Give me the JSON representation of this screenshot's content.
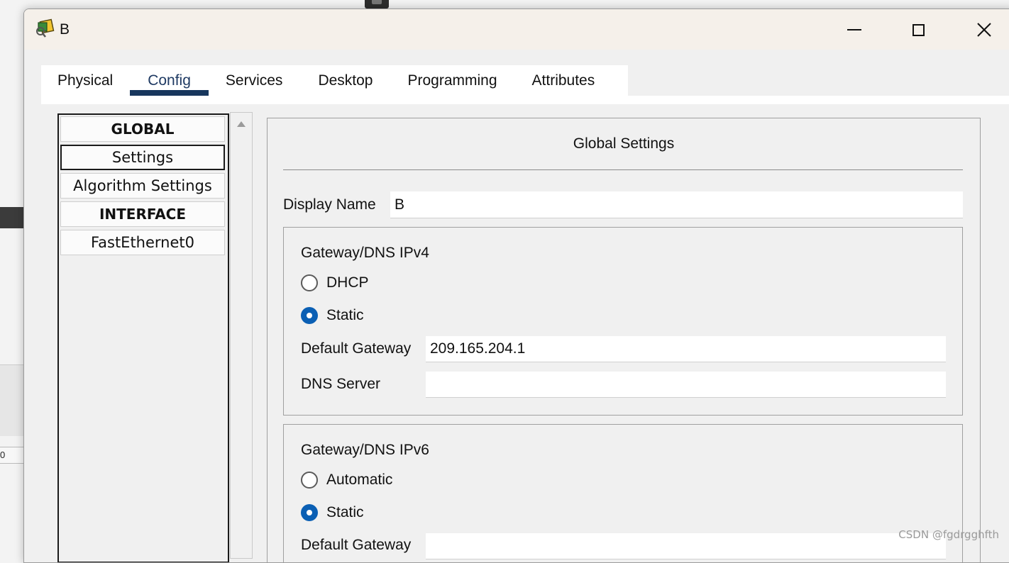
{
  "window": {
    "title": "B"
  },
  "tabs": [
    {
      "label": "Physical"
    },
    {
      "label": "Config"
    },
    {
      "label": "Services"
    },
    {
      "label": "Desktop"
    },
    {
      "label": "Programming"
    },
    {
      "label": "Attributes"
    }
  ],
  "active_tab": "Config",
  "sidebar": {
    "items": [
      {
        "label": "GLOBAL"
      },
      {
        "label": "Settings"
      },
      {
        "label": "Algorithm Settings"
      },
      {
        "label": "INTERFACE"
      },
      {
        "label": "FastEthernet0"
      }
    ],
    "selected": "Settings"
  },
  "settings": {
    "title": "Global Settings",
    "display_name_label": "Display Name",
    "display_name_value": "B",
    "ipv4": {
      "heading": "Gateway/DNS IPv4",
      "dhcp_label": "DHCP",
      "static_label": "Static",
      "mode": "Static",
      "gateway_label": "Default Gateway",
      "gateway_value": "209.165.204.1",
      "dns_label": "DNS Server",
      "dns_value": ""
    },
    "ipv6": {
      "heading": "Gateway/DNS IPv6",
      "auto_label": "Automatic",
      "static_label": "Static",
      "mode": "Static",
      "gateway_label": "Default Gateway"
    }
  },
  "background": {
    "fragment_text": "0"
  },
  "watermark": "CSDN @fgdrgghfth",
  "colors": {
    "accent": "#0a5fb4",
    "tab_underline": "#17365d"
  }
}
